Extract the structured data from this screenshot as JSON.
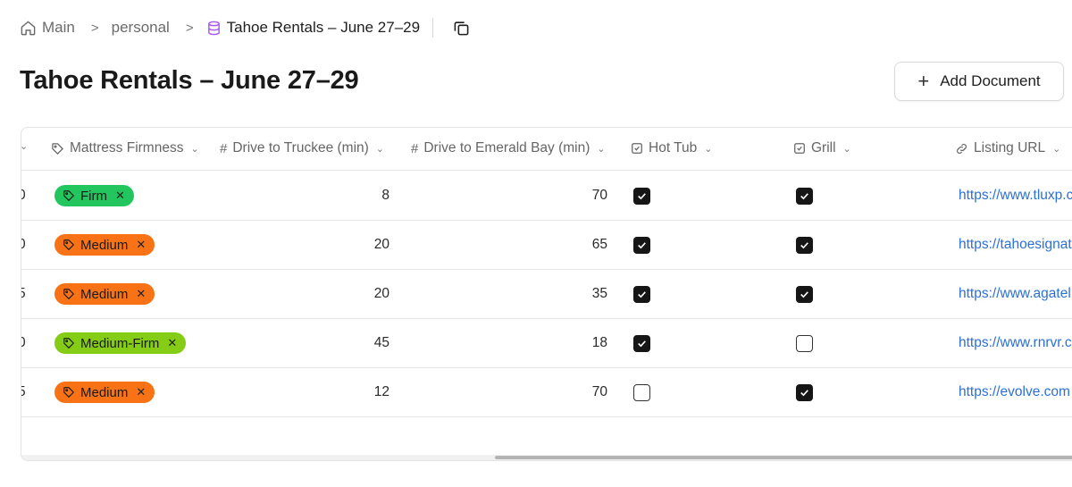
{
  "breadcrumb": {
    "home_label": "Main",
    "folder_label": "personal",
    "current_label": "Tahoe Rentals – June 27–29",
    "separator": ">"
  },
  "page": {
    "title": "Tahoe Rentals – June 27–29"
  },
  "toolbar": {
    "add_document_label": "Add Document"
  },
  "table": {
    "columns": {
      "mattress": "Mattress Firmness",
      "truckee": "Drive to Truckee (min)",
      "emerald": "Drive to Emerald Bay (min)",
      "hottub": "Hot Tub",
      "grill": "Grill",
      "url": "Listing URL"
    },
    "rows": [
      {
        "prev": "0",
        "mattress": "Firm",
        "mattress_color": "#22c55e",
        "truckee": "8",
        "emerald": "70",
        "hottub": true,
        "grill": true,
        "url": "https://www.tluxp.c"
      },
      {
        "prev": "0",
        "mattress": "Medium",
        "mattress_color": "#f97316",
        "truckee": "20",
        "emerald": "65",
        "hottub": true,
        "grill": true,
        "url": "https://tahoesignat"
      },
      {
        "prev": "5",
        "mattress": "Medium",
        "mattress_color": "#f97316",
        "truckee": "20",
        "emerald": "35",
        "hottub": true,
        "grill": true,
        "url": "https://www.agatel"
      },
      {
        "prev": "0",
        "mattress": "Medium-Firm",
        "mattress_color": "#84cc16",
        "truckee": "45",
        "emerald": "18",
        "hottub": true,
        "grill": false,
        "url": "https://www.rnrvr.c"
      },
      {
        "prev": "5",
        "mattress": "Medium",
        "mattress_color": "#f97316",
        "truckee": "12",
        "emerald": "70",
        "hottub": false,
        "grill": true,
        "url": "https://evolve.com"
      }
    ]
  },
  "icons": {
    "home": "home-icon",
    "database": "database-icon",
    "copy": "copy-icon",
    "tag": "tag-icon",
    "hash": "hash-icon",
    "checkbox": "checkbox-icon",
    "link": "link-icon",
    "plus": "plus-icon"
  },
  "colors": {
    "link": "#2c6fd6",
    "database_icon": "#a855f7"
  }
}
